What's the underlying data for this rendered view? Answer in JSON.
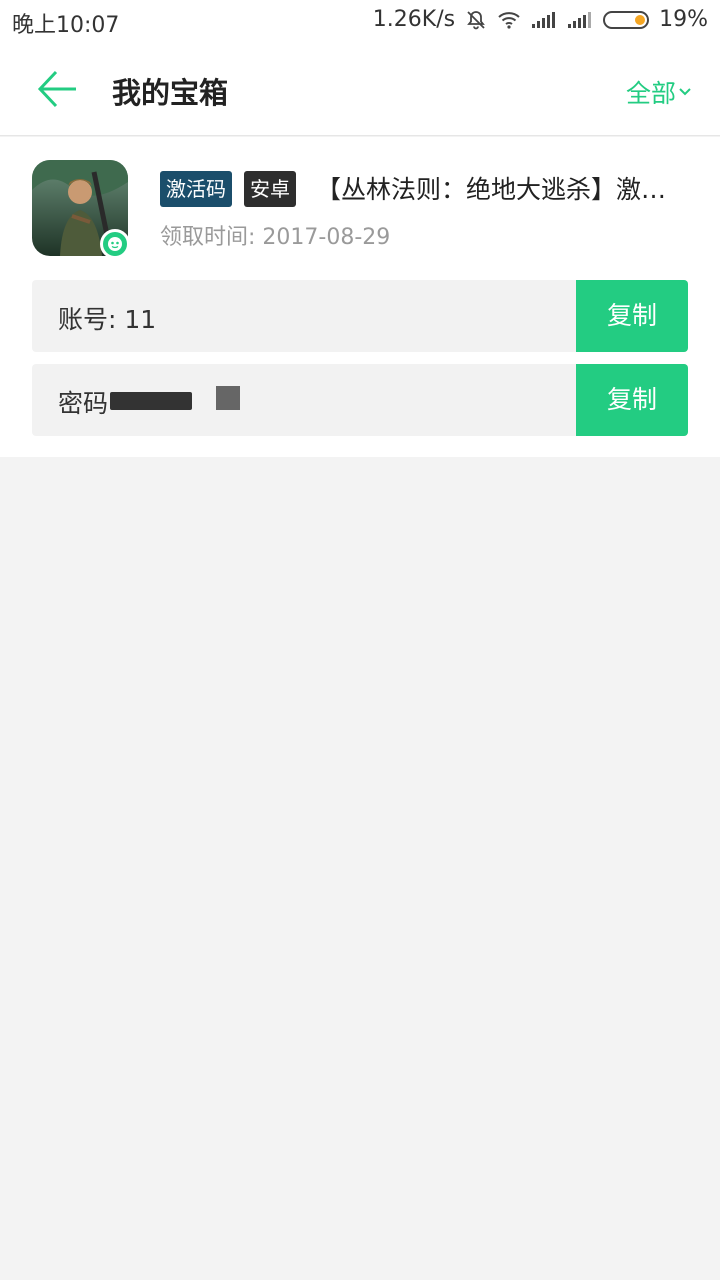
{
  "status_bar": {
    "time": "晚上10:07",
    "net_speed": "1.26K/s",
    "battery": "19%"
  },
  "app_bar": {
    "title": "我的宝箱",
    "filter_label": "全部"
  },
  "item": {
    "tags": [
      "激活码",
      "安卓"
    ],
    "title": "【丛林法则：绝地大逃杀】激活码",
    "claim_time": "领取时间: 2017-08-29",
    "account_label": "账号: 11",
    "password_label": "密码",
    "copy_label": "复制"
  },
  "colors": {
    "accent": "#23cc82",
    "tag_code": "#1b4e6b",
    "tag_android": "#2e2e2e"
  }
}
